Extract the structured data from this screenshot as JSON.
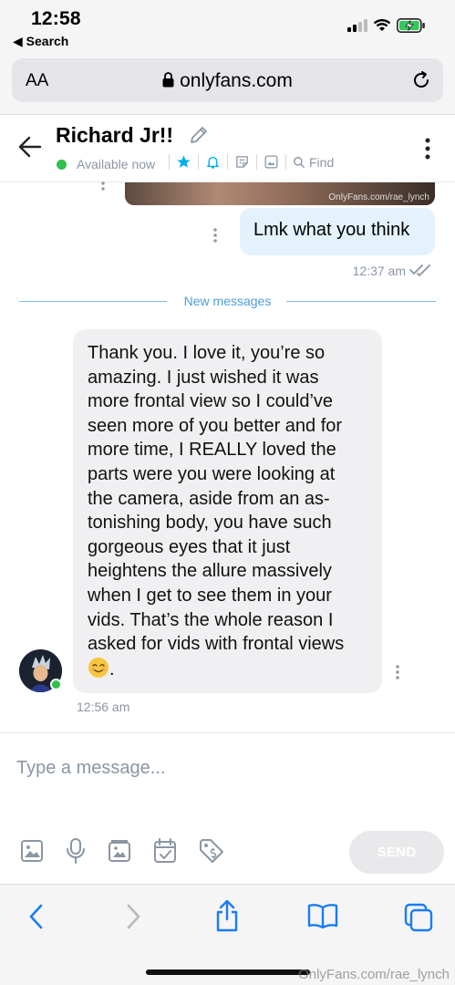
{
  "status_bar": {
    "time": "12:58",
    "back_app": "◀ Search"
  },
  "browser": {
    "text_size": "AA",
    "url": "onlyfans.com"
  },
  "chat": {
    "name": "Richard Jr!!",
    "status": "Available now",
    "find_label": "Find"
  },
  "messages": {
    "media_watermark": "OnlyFans.com/rae_lynch",
    "outgoing": {
      "text": "Lmk what you think",
      "time": "12:37 am"
    },
    "divider": "New messages",
    "incoming": {
      "lines": [
        "Thank you. I love it, you’re so",
        "amazing. I just wished it was",
        "more frontal view so I could’ve",
        "seen more of you better and for",
        "more time, I REALLY loved the",
        "parts were you were looking at",
        "the camera, aside from an as-",
        "tonishing body, you have such",
        "gorgeous eyes that it just",
        "heightens the allure massively",
        "when I get to see them in your",
        "vids. That’s the whole reason I",
        "asked for vids with frontal views"
      ],
      "last_line_suffix": ".",
      "time": "12:56 am"
    }
  },
  "composer": {
    "placeholder": "Type a message...",
    "send_label": "SEND",
    "tools": [
      "image-icon",
      "microphone-icon",
      "vault-icon",
      "calendar-icon",
      "price-tag-icon"
    ]
  },
  "footer_watermark": "OnlyFans.com/rae_lynch",
  "colors": {
    "accent": "#00aff0",
    "online": "#32c04a",
    "muted": "#8a96a3",
    "out_bubble": "#e3f2fd",
    "in_bubble": "#f0f0f2"
  }
}
